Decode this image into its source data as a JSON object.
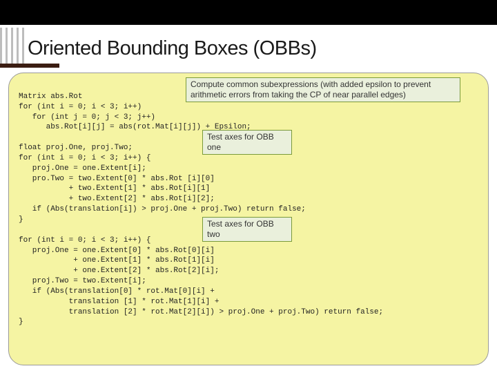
{
  "slide": {
    "title": "Oriented Bounding Boxes (OBBs)"
  },
  "callouts": {
    "c1": "Compute common subexpressions (with added epsilon to prevent arithmetic errors from taking the CP of near parallel edges)",
    "c2": "Test axes for OBB one",
    "c3": "Test axes for OBB two"
  },
  "code": {
    "block1_l1": "Matrix abs.Rot",
    "block1_l2": "for (int i = 0; i < 3; i++)",
    "block1_l3": "   for (int j = 0; j < 3; j++)",
    "block1_l4": "      abs.Rot[i][j] = abs(rot.Mat[i][j]) + Epsilon;",
    "block2_l1": "float proj.One, proj.Two;",
    "block2_l2": "for (int i = 0; i < 3; i++) {",
    "block2_l3": "   proj.One = one.Extent[i];",
    "block2_l4": "   pro.Two = two.Extent[0] * abs.Rot [i][0]",
    "block2_l5": "           + two.Extent[1] * abs.Rot[i][1]",
    "block2_l6": "           + two.Extent[2] * abs.Rot[i][2];",
    "block2_l7": "   if (Abs(translation[i]) > proj.One + proj.Two) return false;",
    "block2_l8": "}",
    "block3_l1": "for (int i = 0; i < 3; i++) {",
    "block3_l2": "   proj.One = one.Extent[0] * abs.Rot[0][i]",
    "block3_l3": "            + one.Extent[1] * abs.Rot[1][i]",
    "block3_l4": "            + one.Extent[2] * abs.Rot[2][i];",
    "block3_l5": "   proj.Two = two.Extent[i];",
    "block3_l6": "   if (Abs(translation[0] * rot.Mat[0][i] +",
    "block3_l7": "           translation [1] * rot.Mat[1][i] +",
    "block3_l8": "           translation [2] * rot.Mat[2][i]) > proj.One + proj.Two) return false;",
    "block3_l9": "}"
  }
}
